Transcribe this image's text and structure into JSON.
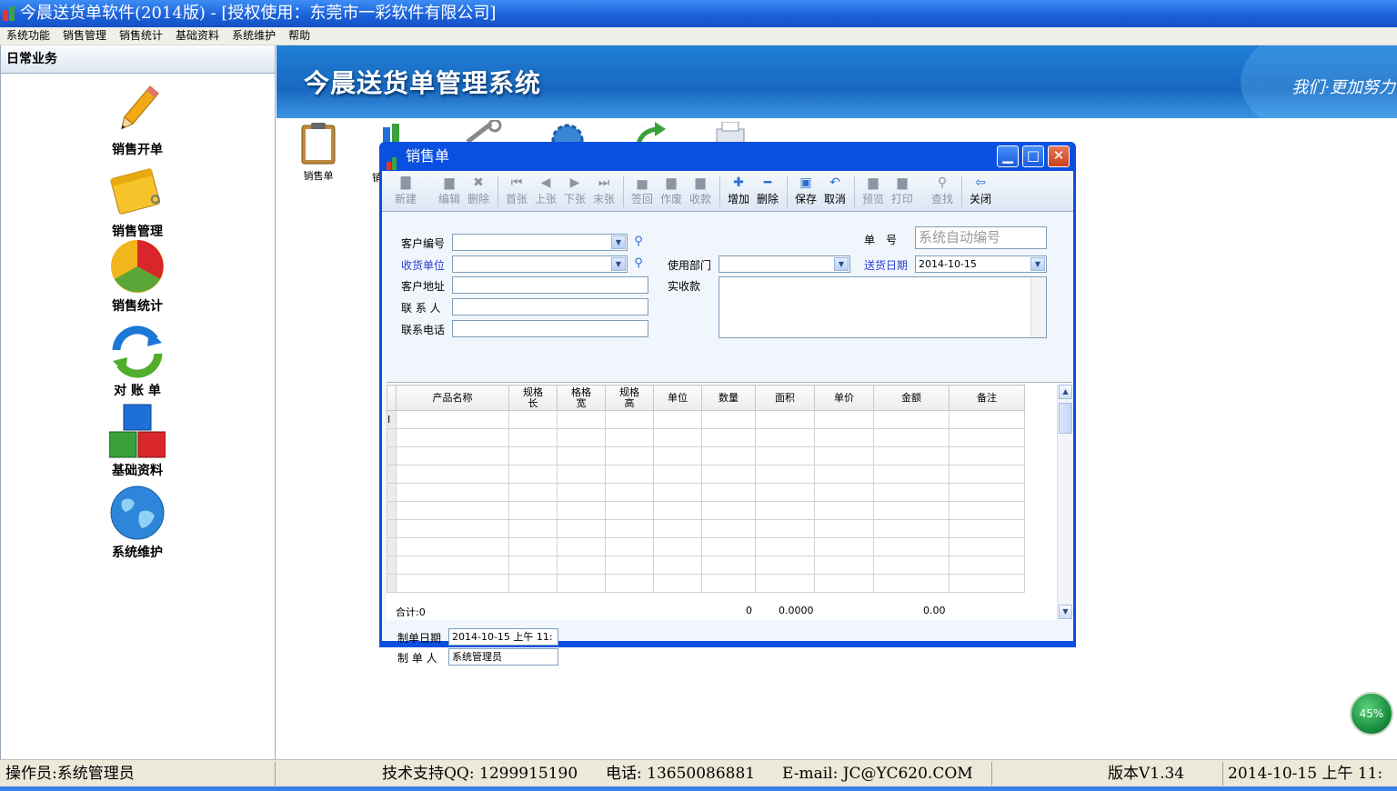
{
  "window": {
    "title": "今晨送货单软件(2014版) - [授权使用：东莞市一彩软件有限公司]"
  },
  "menu": [
    "系统功能",
    "销售管理",
    "销售统计",
    "基础资料",
    "系统维护",
    "帮助"
  ],
  "sidebar": {
    "header": "日常业务",
    "items": [
      {
        "label": "销售开单",
        "icon": "pencil-icon"
      },
      {
        "label": "销售管理",
        "icon": "notepad-icon"
      },
      {
        "label": "销售统计",
        "icon": "pie-chart-icon"
      },
      {
        "label": "对 账 单",
        "icon": "refresh-arrows-icon"
      },
      {
        "label": "基础资料",
        "icon": "blocks-icon"
      },
      {
        "label": "系统维护",
        "icon": "globe-icon"
      }
    ]
  },
  "banner": {
    "title": "今晨送货单管理系统",
    "slogan": "我们·更加努力"
  },
  "quick": {
    "first_label": "销售单",
    "second_label": "销"
  },
  "dialog": {
    "title": "销售单",
    "toolbar": [
      {
        "label": "新建",
        "icon": "new-icon",
        "enabled": false
      },
      {
        "label": "编辑",
        "icon": "edit-icon",
        "enabled": false
      },
      {
        "label": "删除",
        "icon": "delete-icon",
        "enabled": false
      },
      {
        "label": "首张",
        "icon": "first-icon",
        "enabled": false
      },
      {
        "label": "上张",
        "icon": "prev-icon",
        "enabled": false
      },
      {
        "label": "下张",
        "icon": "next-icon",
        "enabled": false
      },
      {
        "label": "末张",
        "icon": "last-icon",
        "enabled": false
      },
      {
        "label": "签回",
        "icon": "sign-back-icon",
        "enabled": false
      },
      {
        "label": "作废",
        "icon": "void-icon",
        "enabled": false
      },
      {
        "label": "收款",
        "icon": "receive-icon",
        "enabled": false
      },
      {
        "label": "增加",
        "icon": "plus-icon",
        "enabled": true
      },
      {
        "label": "删除",
        "icon": "minus-icon",
        "enabled": true
      },
      {
        "label": "保存",
        "icon": "save-icon",
        "enabled": true
      },
      {
        "label": "取消",
        "icon": "undo-icon",
        "enabled": true
      },
      {
        "label": "预览",
        "icon": "preview-icon",
        "enabled": false
      },
      {
        "label": "打印",
        "icon": "print-icon",
        "enabled": false
      },
      {
        "label": "查找",
        "icon": "find-icon",
        "enabled": false
      },
      {
        "label": "关闭",
        "icon": "exit-icon",
        "enabled": true
      }
    ],
    "form": {
      "customer_code_label": "客户编号",
      "receiver_label": "收货单位",
      "address_label": "客户地址",
      "contact_label": "联 系 人",
      "phone_label": "联系电话",
      "order_no_label": "单　号",
      "order_no_placeholder": "系统自动编号",
      "dept_label": "使用部门",
      "delivery_date_label": "送货日期",
      "delivery_date_value": "2014-10-15",
      "paid_label": "实收款"
    },
    "grid": {
      "columns": [
        "产品名称",
        "规格长",
        "格格宽",
        "规格高",
        "单位",
        "数量",
        "面积",
        "单价",
        "金额",
        "备注"
      ],
      "row_marker": "I",
      "total_label": "合计:0",
      "total_qty": "0",
      "total_area": "0.0000",
      "total_amount": "0.00"
    },
    "footer": {
      "created_date_label": "制单日期",
      "created_date_value": "2014-10-15 上午 11:",
      "creator_label": "制 单 人",
      "creator_value": "系统管理员"
    }
  },
  "status": {
    "operator": "操作员:系统管理员",
    "support": "技术支持QQ: 1299915190",
    "phone": "电话: 13650086881",
    "email": "E-mail: JC@YC620.COM",
    "version": "版本V1.34",
    "datetime": "2014-10-15 上午 11:"
  },
  "badge": "45%"
}
